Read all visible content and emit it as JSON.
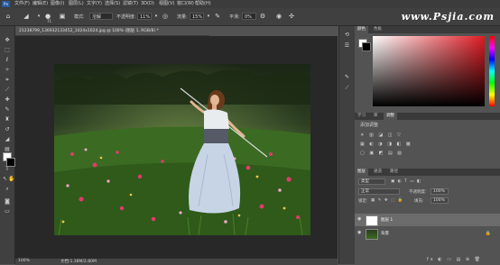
{
  "watermark": "www.Psjia.com",
  "menubar": {
    "logo": "Ps",
    "items": [
      "文件(F)",
      "编辑(E)",
      "图像(I)",
      "图层(L)",
      "文字(Y)",
      "选择(S)",
      "滤镜(T)",
      "3D(D)",
      "视图(V)",
      "窗口(W)",
      "帮助(H)"
    ]
  },
  "options": {
    "brush_size": "71",
    "mode_label": "模式:",
    "mode_value": "溶解",
    "opacity_label": "不透明度:",
    "opacity_value": "11%",
    "flow_label": "流量:",
    "flow_value": "15%",
    "smooth_label": "平滑:",
    "smooth_value": "0%"
  },
  "document": {
    "tab_title": "21238799_136932133452_1024x1024.jpg @ 100% (图层 1, RGB/8) *",
    "zoom": "100%",
    "doc_info": "文档:1.38M/2.80M"
  },
  "panels": {
    "color_tabs": [
      "颜色",
      "色板"
    ],
    "adj_tabs": [
      "学习",
      "库",
      "调整"
    ],
    "adj_title": "添加调整",
    "adj_rows": [
      "☀ ▥ ◪ ◫ ▽",
      "▦ ◐ ◑ ◨ ◧ ▩",
      "▢ ▣ ◩ ▤ ▧"
    ],
    "layer_tabs": [
      "图层",
      "通道",
      "路径"
    ],
    "filter_label": "类型",
    "blend_mode": "正常",
    "opacity_label": "不透明度:",
    "opacity_value": "100%",
    "lock_label": "锁定:",
    "fill_label": "填充:",
    "fill_value": "100%",
    "layers": [
      {
        "name": "图层 1",
        "visible": true,
        "selected": true
      },
      {
        "name": "背景",
        "visible": true,
        "selected": false
      }
    ],
    "footer_icons": "fx ◐ ▭ ▤ ⊕ 🗑"
  },
  "colors": {
    "foreground": "#ffffff",
    "background": "#000000",
    "accent": "#e01c24"
  }
}
